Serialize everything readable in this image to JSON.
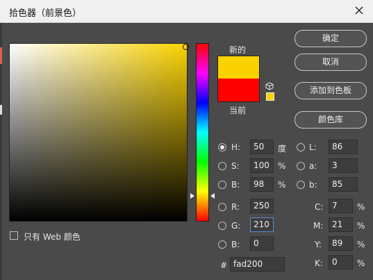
{
  "window": {
    "title": "拾色器（前景色）"
  },
  "preview": {
    "new_label": "新的",
    "current_label": "当前"
  },
  "buttons": {
    "ok": "确定",
    "cancel": "取消",
    "add_to_swatches": "添加到色板",
    "color_libraries": "颜色库"
  },
  "hsb": {
    "h": {
      "label": "H:",
      "value": "50",
      "unit": "度",
      "selected": true
    },
    "s": {
      "label": "S:",
      "value": "100",
      "unit": "%"
    },
    "b": {
      "label": "B:",
      "value": "98",
      "unit": "%"
    }
  },
  "rgb": {
    "r": {
      "label": "R:",
      "value": "250"
    },
    "g": {
      "label": "G:",
      "value": "210"
    },
    "b": {
      "label": "B:",
      "value": "0"
    }
  },
  "lab": {
    "l": {
      "label": "L:",
      "value": "86"
    },
    "a": {
      "label": "a:",
      "value": "3"
    },
    "b": {
      "label": "b:",
      "value": "85"
    }
  },
  "cmyk": {
    "c": {
      "label": "C:",
      "value": "7",
      "unit": "%"
    },
    "m": {
      "label": "M:",
      "value": "21",
      "unit": "%"
    },
    "y": {
      "label": "Y:",
      "value": "89",
      "unit": "%"
    },
    "k": {
      "label": "K:",
      "value": "0",
      "unit": "%"
    }
  },
  "hex": {
    "label": "#",
    "value": "fad200"
  },
  "web_only": {
    "label": "只有 Web 颜色",
    "checked": false
  },
  "colors": {
    "new": "#fad200",
    "current": "#ff0000",
    "hue_base": "#fad200"
  },
  "icons": {
    "close": "close-icon",
    "cube": "cube-icon"
  }
}
